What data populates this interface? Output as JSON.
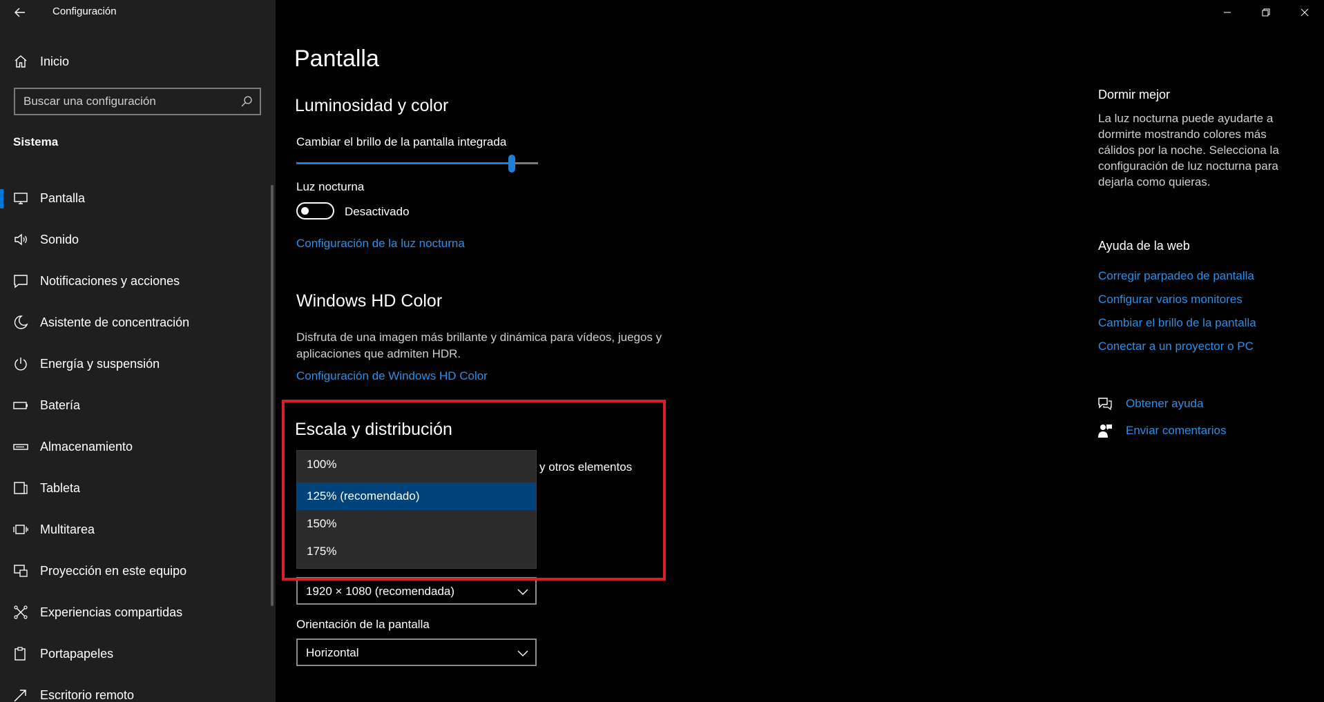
{
  "window": {
    "title": "Configuración"
  },
  "sidebar": {
    "home_label": "Inicio",
    "search_placeholder": "Buscar una configuración",
    "section_label": "Sistema",
    "items": [
      {
        "label": "Pantalla",
        "icon": "monitor-icon",
        "active": true
      },
      {
        "label": "Sonido",
        "icon": "speaker-icon"
      },
      {
        "label": "Notificaciones y acciones",
        "icon": "notification-icon"
      },
      {
        "label": "Asistente de concentración",
        "icon": "moon-icon"
      },
      {
        "label": "Energía y suspensión",
        "icon": "power-icon"
      },
      {
        "label": "Batería",
        "icon": "battery-icon"
      },
      {
        "label": "Almacenamiento",
        "icon": "storage-icon"
      },
      {
        "label": "Tableta",
        "icon": "tablet-icon"
      },
      {
        "label": "Multitarea",
        "icon": "multitask-icon"
      },
      {
        "label": "Proyección en este equipo",
        "icon": "projection-icon"
      },
      {
        "label": "Experiencias compartidas",
        "icon": "share-icon"
      },
      {
        "label": "Portapapeles",
        "icon": "clipboard-icon"
      },
      {
        "label": "Escritorio remoto",
        "icon": "remote-desktop-icon"
      }
    ]
  },
  "main": {
    "page_title": "Pantalla",
    "brightness": {
      "heading": "Luminosidad y color",
      "slider_label": "Cambiar el brillo de la pantalla integrada",
      "slider_value_percent": 89,
      "night_light_label": "Luz nocturna",
      "toggle_state": "Desactivado",
      "night_light_link": "Configuración de la luz nocturna"
    },
    "hdr": {
      "heading": "Windows HD Color",
      "description_line1": "Disfruta de una imagen más brillante y dinámica para vídeos, juegos y",
      "description_line2": "aplicaciones que admiten HDR.",
      "link": "Configuración de Windows HD Color"
    },
    "scale": {
      "heading": "Escala y distribución",
      "partial_label": "y otros elementos",
      "options": [
        "100%",
        "125% (recomendado)",
        "150%",
        "175%"
      ],
      "selected_index": 1,
      "resolution_value": "1920 × 1080 (recomendada)",
      "orientation_label": "Orientación de la pantalla",
      "orientation_value": "Horizontal"
    }
  },
  "right_panel": {
    "sleep_heading": "Dormir mejor",
    "sleep_description": "La luz nocturna puede ayudarte a dormirte mostrando colores más cálidos por la noche. Selecciona la configuración de luz nocturna para dejarla como quieras.",
    "web_help_heading": "Ayuda de la web",
    "web_links": [
      "Corregir parpadeo de pantalla",
      "Configurar varios monitores",
      "Cambiar el brillo de la pantalla",
      "Conectar a un proyector o PC"
    ],
    "get_help": "Obtener ayuda",
    "feedback": "Enviar comentarios"
  },
  "colors": {
    "accent": "#0078d7",
    "link": "#2b8fe6",
    "highlight_border": "#d61f2b",
    "dropdown_selected": "#00437a"
  }
}
